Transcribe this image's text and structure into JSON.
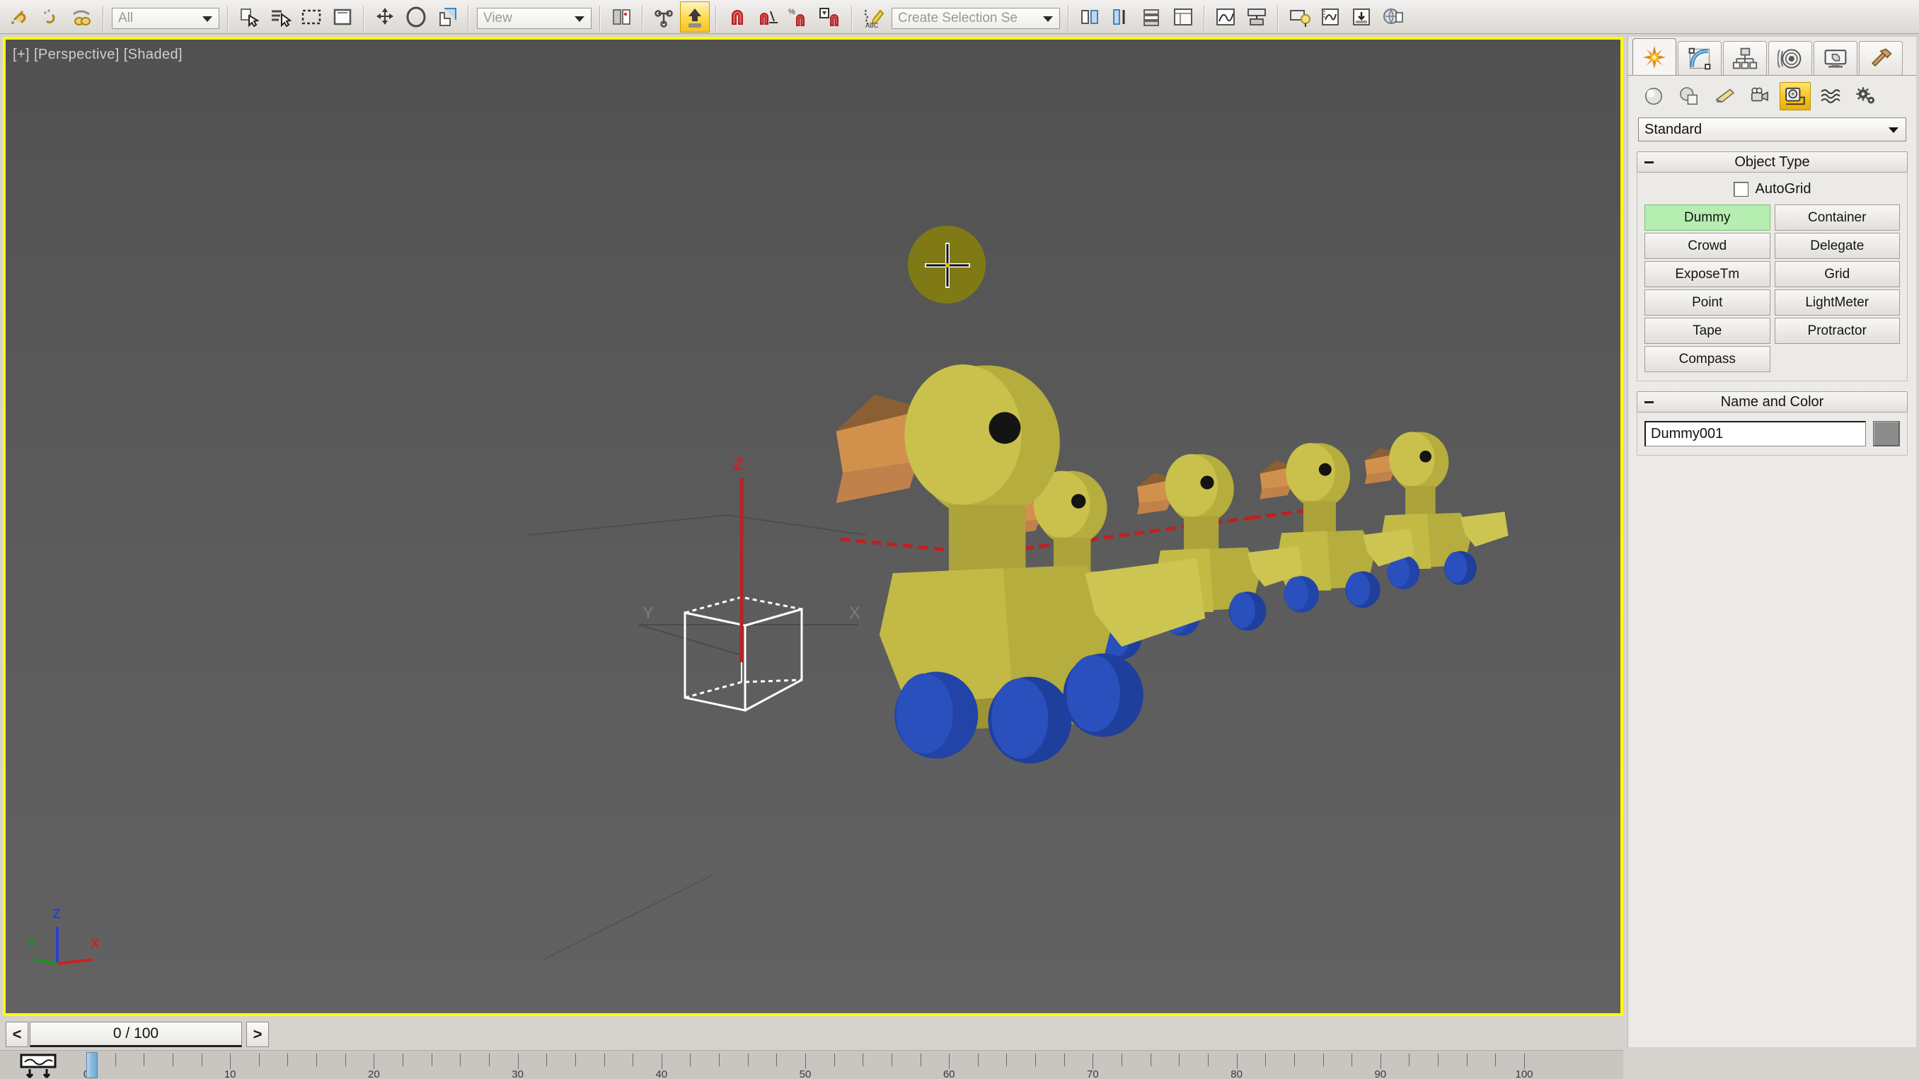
{
  "toolbar": {
    "groups": [
      {
        "items": [
          {
            "name": "unlink-selection-icon",
            "label": "Unlink Selection",
            "type": "icon"
          },
          {
            "name": "bind-to-space-warp-icon",
            "label": "Bind to Space Warp",
            "type": "icon"
          },
          {
            "name": "link-chain-icon",
            "label": "Link",
            "type": "icon"
          }
        ]
      },
      {
        "items": [
          {
            "name": "selection-filter-combo",
            "label": "All",
            "type": "combo",
            "width": "combo-all"
          }
        ]
      },
      {
        "items": [
          {
            "name": "select-object-icon",
            "label": "Select Object",
            "type": "icon"
          },
          {
            "name": "select-by-name-icon",
            "label": "Select by Name",
            "type": "icon"
          },
          {
            "name": "rectangular-selection-region-icon",
            "label": "Rectangular Selection Region",
            "type": "icon"
          },
          {
            "name": "window-crossing-icon",
            "label": "Window / Crossing",
            "type": "icon"
          }
        ]
      },
      {
        "items": [
          {
            "name": "select-and-move-icon",
            "label": "Select and Move",
            "type": "icon"
          },
          {
            "name": "select-and-rotate-icon",
            "label": "Select and Rotate",
            "type": "icon"
          },
          {
            "name": "select-and-scale-icon",
            "label": "Select and Uniform Scale",
            "type": "icon"
          }
        ]
      },
      {
        "items": [
          {
            "name": "reference-coordinate-system-combo",
            "label": "View",
            "type": "combo",
            "width": "combo-view"
          }
        ]
      },
      {
        "items": [
          {
            "name": "use-pivot-point-center-icon",
            "label": "Use Pivot Point Center",
            "type": "icon"
          }
        ]
      },
      {
        "items": [
          {
            "name": "select-and-manipulate-icon",
            "label": "Select and Manipulate",
            "type": "icon"
          },
          {
            "name": "keyboard-shortcut-override-icon",
            "label": "Keyboard Shortcut Override Toggle",
            "type": "icon",
            "active": true
          }
        ]
      },
      {
        "items": [
          {
            "name": "snaps-toggle-icon",
            "label": "Snaps Toggle",
            "type": "icon"
          },
          {
            "name": "angle-snap-toggle-icon",
            "label": "Angle Snap Toggle",
            "type": "icon"
          },
          {
            "name": "percent-snap-toggle-icon",
            "label": "Percent Snap Toggle",
            "type": "icon"
          },
          {
            "name": "spinner-snap-toggle-icon",
            "label": "Spinner Snap Toggle",
            "type": "icon"
          }
        ]
      },
      {
        "items": [
          {
            "name": "edit-named-selection-sets-icon",
            "label": "Edit Named Selection Sets",
            "type": "icon"
          },
          {
            "name": "named-selection-set-combo",
            "label": "Create Selection Se",
            "type": "combo",
            "width": "combo-sel"
          }
        ]
      },
      {
        "items": [
          {
            "name": "mirror-icon",
            "label": "Mirror",
            "type": "icon"
          },
          {
            "name": "align-icon",
            "label": "Align",
            "type": "icon"
          },
          {
            "name": "layer-manager-icon",
            "label": "Layer Manager",
            "type": "icon"
          },
          {
            "name": "toggle-scene-explorer-icon",
            "label": "Toggle Scene Explorer",
            "type": "icon"
          }
        ]
      },
      {
        "items": [
          {
            "name": "curve-editor-icon",
            "label": "Curve Editor",
            "type": "icon"
          },
          {
            "name": "schematic-view-icon",
            "label": "Schematic View",
            "type": "icon"
          }
        ]
      },
      {
        "items": [
          {
            "name": "material-editor-icon",
            "label": "Material Editor",
            "type": "icon"
          },
          {
            "name": "render-setup-icon",
            "label": "Render Setup",
            "type": "icon"
          },
          {
            "name": "rendered-frame-window-icon",
            "label": "Rendered Frame Window",
            "type": "icon"
          },
          {
            "name": "render-production-icon",
            "label": "Render Production",
            "type": "icon"
          }
        ]
      }
    ]
  },
  "viewport": {
    "label": "[+] [Perspective] [Shaded]",
    "background_top": "#515151",
    "background_bottom": "#626262",
    "active_border_color": "#ffff00",
    "tripod": {
      "z_label": "Z",
      "z_color": "#2b3fd6",
      "y_label": "Y",
      "y_color": "#1d8f27",
      "x_label": "X",
      "x_color": "#cc2222"
    },
    "dummy_helper": {
      "name": "Dummy001",
      "wire_color": "#ffffff",
      "z_axis_color": "#bb2222",
      "ground_line_color": "#4a4a4a"
    },
    "cursor": {
      "name": "crosshair-cursor",
      "highlight_circle_color": "#807a16"
    },
    "scene": {
      "description": "Toy duck pull-train",
      "duck_count": 5,
      "body_color": "#b5ad3d",
      "body_shade_dark": "#8e8830",
      "body_highlight": "#c9c14c",
      "beak_color": "#d1914d",
      "beak_shade": "#8a5f33",
      "wheel_color": "#2244a8",
      "wheel_shade": "#1a3486",
      "eye_color": "#141414",
      "link_line_color": "#c02020"
    }
  },
  "frame_bar": {
    "prev_label": "<",
    "next_label": ">",
    "current_frame": "0 / 100"
  },
  "timeline": {
    "key_mode_icon": "key-mode-toggle-icon",
    "start": 0,
    "end": 100,
    "major_step": 10,
    "minor_step": 2,
    "tick_labels": [
      0,
      10,
      20,
      30,
      40,
      50,
      60,
      70,
      80,
      90,
      100
    ],
    "slider_frame": 0
  },
  "command_panel": {
    "tabs": [
      {
        "name": "tab-create",
        "icon": "create-star-icon",
        "label": "Create",
        "active": true
      },
      {
        "name": "tab-modify",
        "icon": "modify-curve-icon",
        "label": "Modify",
        "active": false
      },
      {
        "name": "tab-hierarchy",
        "icon": "hierarchy-tree-icon",
        "label": "Hierarchy",
        "active": false
      },
      {
        "name": "tab-motion",
        "icon": "motion-wheel-icon",
        "label": "Motion",
        "active": false
      },
      {
        "name": "tab-display",
        "icon": "display-monitor-icon",
        "label": "Display",
        "active": false
      },
      {
        "name": "tab-utilities",
        "icon": "utilities-hammer-icon",
        "label": "Utilities",
        "active": false
      }
    ],
    "categories": [
      {
        "name": "category-geometry",
        "icon": "sphere-icon",
        "label": "Geometry",
        "active": false
      },
      {
        "name": "category-shapes",
        "icon": "shapes-icon",
        "label": "Shapes",
        "active": false
      },
      {
        "name": "category-lights",
        "icon": "light-icon",
        "label": "Lights",
        "active": false
      },
      {
        "name": "category-cameras",
        "icon": "camera-icon",
        "label": "Cameras",
        "active": false
      },
      {
        "name": "category-helpers",
        "icon": "tape-measure-icon",
        "label": "Helpers",
        "active": true
      },
      {
        "name": "category-spacewarps",
        "icon": "waves-icon",
        "label": "Space Warps",
        "active": false
      },
      {
        "name": "category-systems",
        "icon": "gears-icon",
        "label": "Systems",
        "active": false
      }
    ],
    "subcategory": {
      "name": "helper-subcategory-dropdown",
      "value": "Standard"
    },
    "object_type": {
      "rollout_title": "Object Type",
      "autogrid_label": "AutoGrid",
      "autogrid_checked": false,
      "buttons": [
        {
          "label": "Dummy",
          "selected": true
        },
        {
          "label": "Container",
          "selected": false
        },
        {
          "label": "Crowd",
          "selected": false
        },
        {
          "label": "Delegate",
          "selected": false
        },
        {
          "label": "ExposeTm",
          "selected": false
        },
        {
          "label": "Grid",
          "selected": false
        },
        {
          "label": "Point",
          "selected": false
        },
        {
          "label": "LightMeter",
          "selected": false
        },
        {
          "label": "Tape",
          "selected": false
        },
        {
          "label": "Protractor",
          "selected": false
        },
        {
          "label": "Compass",
          "selected": false
        }
      ]
    },
    "name_and_color": {
      "rollout_title": "Name and Color",
      "name_value": "Dummy001",
      "color_value": "#8c8c8c"
    }
  }
}
